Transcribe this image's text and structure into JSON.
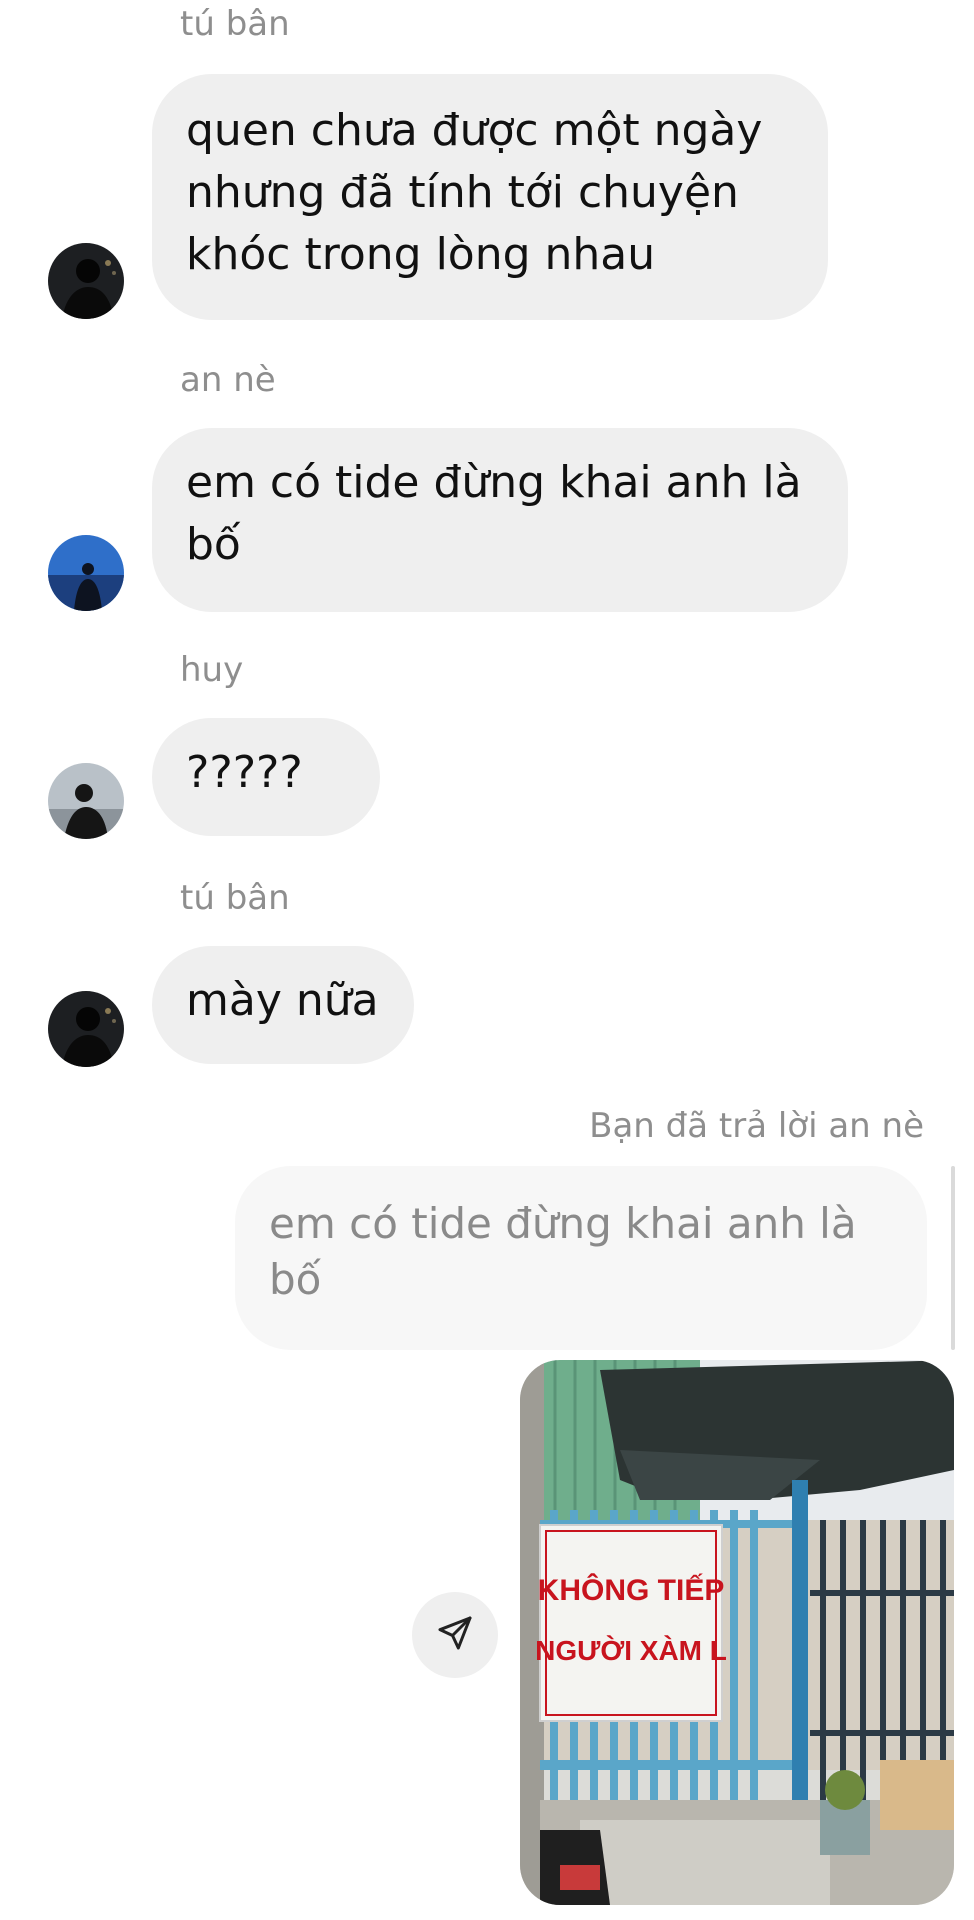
{
  "messages": [
    {
      "sender": "tú bân",
      "text": "quen chưa được một ngày nhưng đã tính tới chuyện khóc trong lòng nhau"
    },
    {
      "sender": "an nè",
      "text": "em có tide đừng khai anh là bố"
    },
    {
      "sender": "huy",
      "text": "?????"
    },
    {
      "sender": "tú bân",
      "text": "mày nữa"
    }
  ],
  "reply": {
    "label": "Bạn đã trả lời an nè",
    "quoted_text": "em có tide đừng khai anh là bố"
  },
  "photo": {
    "sign_line1": "KHÔNG TIẾP",
    "sign_line2": "NGƯỜI XÀM L"
  },
  "icons": {
    "share": "paper-plane-icon"
  },
  "colors": {
    "bubble": "#efefef",
    "quote_bubble": "#f7f7f7",
    "secondary_text": "#8e8e8e",
    "sign_text": "#c8141e"
  }
}
